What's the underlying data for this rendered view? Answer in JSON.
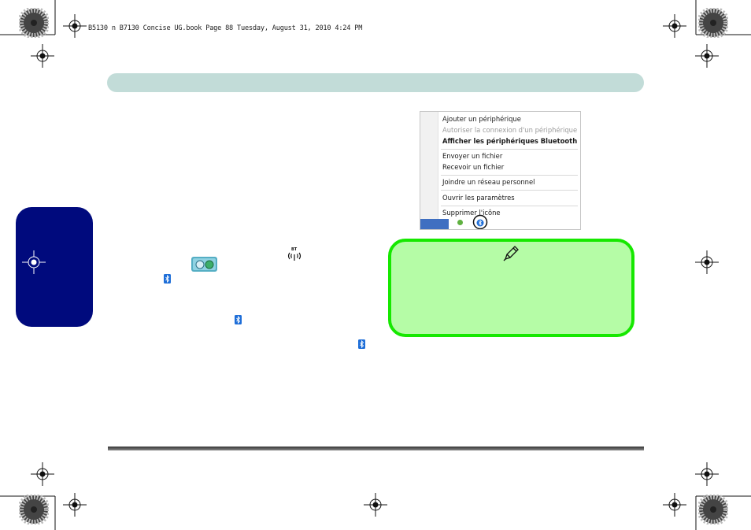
{
  "header": {
    "line": "B5130 n B7130 Concise UG.book  Page 88  Tuesday, August 31, 2010  4:24 PM"
  },
  "context_menu": {
    "items": [
      {
        "label": "Ajouter un périphérique",
        "state": "normal"
      },
      {
        "label": "Autoriser la connexion d'un périphérique",
        "state": "disabled"
      },
      {
        "label": "Afficher les périphériques Bluetooth",
        "state": "bold"
      },
      {
        "label": "Envoyer un fichier",
        "state": "normal"
      },
      {
        "label": "Recevoir un fichier",
        "state": "normal"
      },
      {
        "label": "Joindre un réseau personnel",
        "state": "normal"
      },
      {
        "label": "Ouvrir les paramètres",
        "state": "normal"
      },
      {
        "label": "Supprimer l'icône",
        "state": "normal"
      }
    ]
  },
  "icons": {
    "bt_module_label": "BT",
    "bt_module_icon": "bluetooth-module-led-icon",
    "wireless_switch_icon": "bluetooth-wifi-switch-icon",
    "bt_tray_icon": "bluetooth-icon",
    "note_icon": "pencil-icon",
    "registration_mark_icon": "crosshair-icon",
    "starburst_icon": "printer-starburst-icon"
  },
  "colors": {
    "top_bar": "#c2dcd8",
    "side_tab": "#000a7d",
    "note_fill": "#b5fca6",
    "note_border": "#16e800",
    "bluetooth_blue": "#1e6ed8"
  }
}
